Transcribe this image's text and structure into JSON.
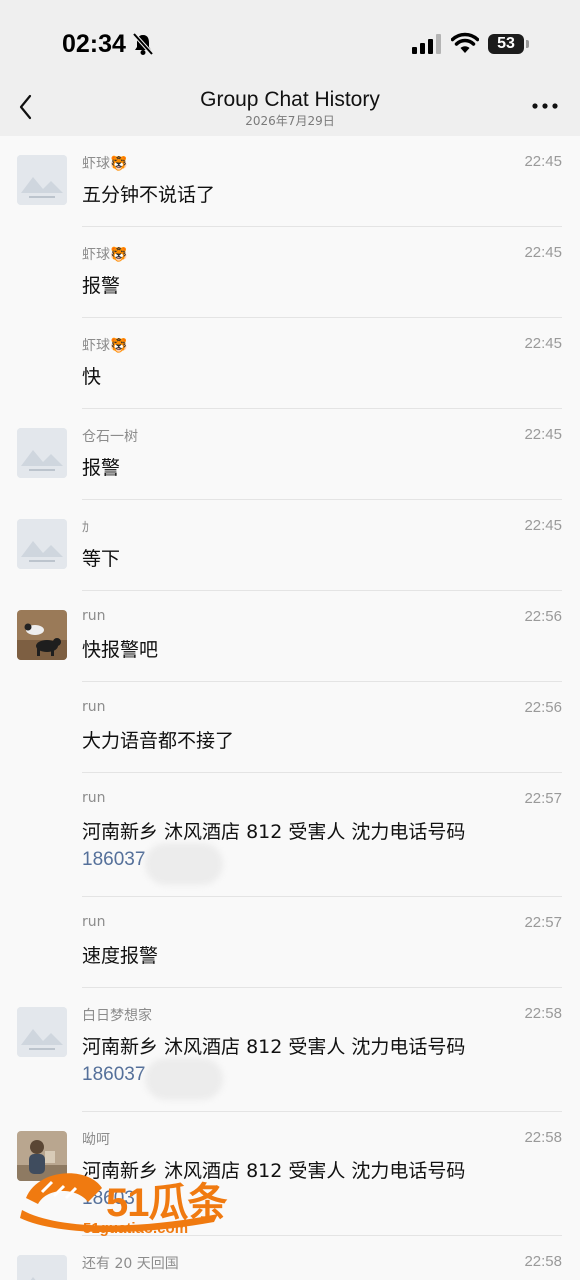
{
  "status": {
    "time": "02:34",
    "battery": "53"
  },
  "nav": {
    "title": "Group Chat History",
    "subtitle": "2026年7月29日"
  },
  "messages": [
    {
      "sender": "虾球🐯",
      "time": "22:45",
      "text": "五分钟不说话了",
      "avatar": "placeholder"
    },
    {
      "sender": "虾球🐯",
      "time": "22:45",
      "text": "报警",
      "avatar": "none"
    },
    {
      "sender": "虾球🐯",
      "time": "22:45",
      "text": "快",
      "avatar": "none"
    },
    {
      "sender": "仓石一树",
      "time": "22:45",
      "text": "报警",
      "avatar": "placeholder"
    },
    {
      "sender": "ｶ",
      "time": "22:45",
      "text": "等下",
      "avatar": "placeholder"
    },
    {
      "sender": "run",
      "time": "22:56",
      "text": "快报警吧",
      "avatar": "cats"
    },
    {
      "sender": "run",
      "time": "22:56",
      "text": "大力语音都不接了",
      "avatar": "none"
    },
    {
      "sender": "run",
      "time": "22:57",
      "text": "河南新乡 沐风酒店 812 受害人 沈力电话号码",
      "phone": "186037",
      "avatar": "none"
    },
    {
      "sender": "run",
      "time": "22:57",
      "text": "速度报警",
      "avatar": "none"
    },
    {
      "sender": "白日梦想家",
      "time": "22:58",
      "text": "河南新乡 沐风酒店 812 受害人 沈力电话号码",
      "phone": "186037",
      "avatar": "placeholder"
    },
    {
      "sender": "呦呵",
      "time": "22:58",
      "text": "河南新乡 沐风酒店 812 受害人 沈力电话号码",
      "phone": "18603",
      "avatar": "person"
    },
    {
      "sender": "还有 20 天回国",
      "time": "22:58",
      "text": "",
      "avatar": "placeholder"
    }
  ],
  "watermark": {
    "big": "51瓜条",
    "small": "51guatiao.com"
  },
  "colors": {
    "header_bg": "#efefef",
    "phone_link": "#55709a",
    "watermark": "#f07a10"
  }
}
